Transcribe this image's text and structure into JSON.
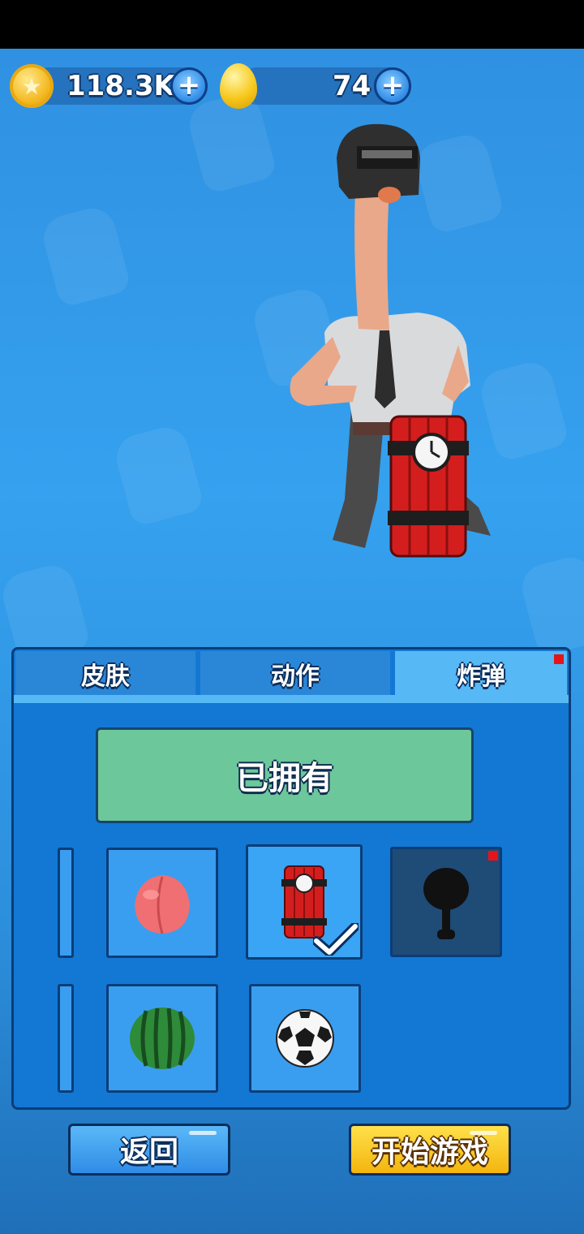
{
  "currency": {
    "coins": "118.3K",
    "eggs": "74",
    "plus_label": "+"
  },
  "tabs": [
    {
      "label": "皮肤",
      "active": false
    },
    {
      "label": "动作",
      "active": false
    },
    {
      "label": "炸弹",
      "active": true,
      "has_notification": true
    }
  ],
  "status": {
    "owned_label": "已拥有"
  },
  "grid": {
    "row1": [
      {
        "item": "partial-item",
        "state": "normal"
      },
      {
        "item": "peach",
        "icon": "peach-icon",
        "state": "normal"
      },
      {
        "item": "dynamite",
        "icon": "dynamite-icon",
        "state": "selected"
      },
      {
        "item": "frying-pan",
        "icon": "frying-pan-icon",
        "state": "locked",
        "has_notification": true
      }
    ],
    "row2": [
      {
        "item": "partial-item",
        "state": "normal"
      },
      {
        "item": "watermelon",
        "icon": "watermelon-icon",
        "state": "normal"
      },
      {
        "item": "soccer-ball",
        "icon": "soccer-ball-icon",
        "state": "normal"
      }
    ]
  },
  "buttons": {
    "back": "返回",
    "start": "开始游戏"
  },
  "colors": {
    "accent_blue": "#1378d4",
    "owned_green": "#6cc79a",
    "start_yellow": "#f3b50e",
    "notification_red": "#e5141b"
  }
}
